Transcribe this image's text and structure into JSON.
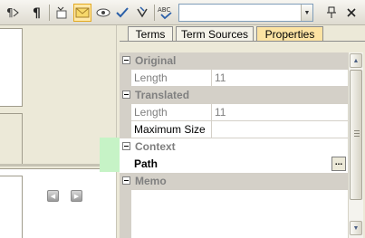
{
  "toolbar": {
    "search_value": "",
    "buttons": [
      "show-formatting-icon",
      "pilcrow-icon",
      "insert-icon",
      "message-icon",
      "preview-icon",
      "checkmark-icon",
      "clear-icon",
      "spellcheck-icon"
    ],
    "spellcheck_label": "ABC",
    "pin_icon": "pin-icon",
    "close_icon": "close-icon"
  },
  "tabs": [
    {
      "label": "Terms",
      "active": false
    },
    {
      "label": "Term Sources",
      "active": false
    },
    {
      "label": "Properties",
      "active": true
    }
  ],
  "properties": {
    "original": {
      "title": "Original",
      "length_label": "Length",
      "length_value": "11"
    },
    "translated": {
      "title": "Translated",
      "length_label": "Length",
      "length_value": "11",
      "max_size_label": "Maximum Size",
      "max_size_value": ""
    },
    "context": {
      "title": "Context",
      "path_label": "Path",
      "path_value": "",
      "ellipsis_label": "..."
    },
    "memo": {
      "title": "Memo"
    }
  },
  "colors": {
    "context_highlight": "#c6f3c6",
    "active_tab": "#fce3a3",
    "category_header": "#d4d0c8"
  }
}
